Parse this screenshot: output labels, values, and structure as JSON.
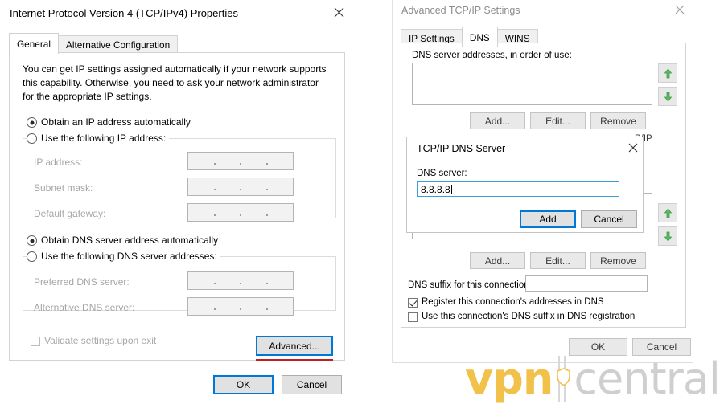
{
  "ipv4_dialog": {
    "title": "Internet Protocol Version 4 (TCP/IPv4) Properties",
    "close_icon": "close-icon",
    "tabs": [
      {
        "label": "General",
        "selected": true
      },
      {
        "label": "Alternative Configuration",
        "selected": false
      }
    ],
    "description": "You can get IP settings assigned automatically if your network supports this capability. Otherwise, you need to ask your network administrator for the appropriate IP settings.",
    "ip_mode": {
      "auto_label": "Obtain an IP address automatically",
      "manual_label": "Use the following IP address:",
      "selected": "auto"
    },
    "ip_fields": [
      {
        "label": "IP address:",
        "value": "",
        "enabled": false
      },
      {
        "label": "Subnet mask:",
        "value": "",
        "enabled": false
      },
      {
        "label": "Default gateway:",
        "value": "",
        "enabled": false
      }
    ],
    "dns_mode": {
      "auto_label": "Obtain DNS server address automatically",
      "manual_label": "Use the following DNS server addresses:",
      "selected": "auto"
    },
    "dns_fields": [
      {
        "label": "Preferred DNS server:",
        "value": "",
        "enabled": false
      },
      {
        "label": "Alternative DNS server:",
        "value": "",
        "enabled": false
      }
    ],
    "validate_checkbox": {
      "label": "Validate settings upon exit",
      "checked": false
    },
    "advanced_button": "Advanced...",
    "ok_button": "OK",
    "cancel_button": "Cancel"
  },
  "advanced_dialog": {
    "title": "Advanced TCP/IP Settings",
    "close_icon": "close-icon",
    "tabs": [
      {
        "label": "IP Settings",
        "selected": false
      },
      {
        "label": "DNS",
        "selected": true
      },
      {
        "label": "WINS",
        "selected": false
      }
    ],
    "dns_list_label": "DNS server addresses, in order of use:",
    "dns_list_items": [],
    "list_buttons": [
      {
        "label": "Add...",
        "enabled": true
      },
      {
        "label": "Edit...",
        "enabled": false
      },
      {
        "label": "Remove",
        "enabled": false
      }
    ],
    "suffix_section_partial_text": "P/IP",
    "suffix_buttons": [
      {
        "label": "Add...",
        "enabled": false
      },
      {
        "label": "Edit...",
        "enabled": false
      },
      {
        "label": "Remove",
        "enabled": false
      }
    ],
    "dns_suffix_label": "DNS suffix for this connection:",
    "dns_suffix_value": "",
    "register_checkbox": {
      "label": "Register this connection's addresses in DNS",
      "checked": true
    },
    "use_suffix_checkbox": {
      "label": "Use this connection's DNS suffix in DNS registration",
      "checked": false
    },
    "ok_button": "OK",
    "cancel_button": "Cancel",
    "move_up_icon": "arrow-up-icon",
    "move_down_icon": "arrow-down-icon"
  },
  "dns_server_modal": {
    "title": "TCP/IP DNS Server",
    "close_icon": "close-icon",
    "field_label": "DNS server:",
    "field_value": "8.8.8.8",
    "add_button": "Add",
    "cancel_button": "Cancel"
  },
  "watermark": {
    "brand_bold": "vpn",
    "brand_light": "central",
    "shield_icon": "shield-icon",
    "color_bold": "#f2c14a",
    "color_light": "#cfcfcf"
  },
  "annotation": {
    "highlight_color": "#c0201b"
  }
}
